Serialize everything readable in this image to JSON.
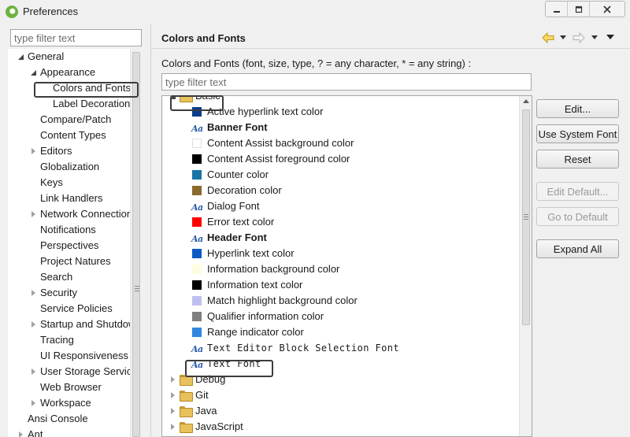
{
  "window": {
    "title": "Preferences",
    "controls": [
      "minimize-icon",
      "restore-icon",
      "close-icon"
    ]
  },
  "left": {
    "filter_placeholder": "type filter text",
    "tree": [
      {
        "label": "General",
        "level": 0,
        "expander": "open"
      },
      {
        "label": "Appearance",
        "level": 1,
        "expander": "open"
      },
      {
        "label": "Colors and Fonts",
        "level": 2,
        "expander": "none",
        "selected": true
      },
      {
        "label": "Label Decorations",
        "level": 2,
        "expander": "none"
      },
      {
        "label": "Compare/Patch",
        "level": 1,
        "expander": "none"
      },
      {
        "label": "Content Types",
        "level": 1,
        "expander": "none"
      },
      {
        "label": "Editors",
        "level": 1,
        "expander": "closed"
      },
      {
        "label": "Globalization",
        "level": 1,
        "expander": "none"
      },
      {
        "label": "Keys",
        "level": 1,
        "expander": "none"
      },
      {
        "label": "Link Handlers",
        "level": 1,
        "expander": "none"
      },
      {
        "label": "Network Connections",
        "level": 1,
        "expander": "closed"
      },
      {
        "label": "Notifications",
        "level": 1,
        "expander": "none"
      },
      {
        "label": "Perspectives",
        "level": 1,
        "expander": "none"
      },
      {
        "label": "Project Natures",
        "level": 1,
        "expander": "none"
      },
      {
        "label": "Search",
        "level": 1,
        "expander": "none"
      },
      {
        "label": "Security",
        "level": 1,
        "expander": "closed"
      },
      {
        "label": "Service Policies",
        "level": 1,
        "expander": "none"
      },
      {
        "label": "Startup and Shutdown",
        "level": 1,
        "expander": "closed"
      },
      {
        "label": "Tracing",
        "level": 1,
        "expander": "none"
      },
      {
        "label": "UI Responsiveness",
        "level": 1,
        "expander": "none"
      },
      {
        "label": "User Storage Service",
        "level": 1,
        "expander": "closed"
      },
      {
        "label": "Web Browser",
        "level": 1,
        "expander": "none"
      },
      {
        "label": "Workspace",
        "level": 1,
        "expander": "closed"
      },
      {
        "label": "Ansi Console",
        "level": 0,
        "expander": "none"
      },
      {
        "label": "Ant",
        "level": 0,
        "expander": "closed"
      }
    ]
  },
  "right": {
    "title": "Colors and Fonts",
    "nav_icons": [
      "back-arrow-icon",
      "back-menu-icon",
      "forward-arrow-icon",
      "forward-menu-icon",
      "view-menu-icon"
    ],
    "description": "Colors and Fonts (font, size, type, ? = any character, * = any string) :",
    "filter_placeholder": "type filter text",
    "items": [
      {
        "label": "Basic",
        "kind": "category",
        "expander": "open"
      },
      {
        "label": "Active hyperlink text color",
        "kind": "color",
        "color": "#0a3c8c"
      },
      {
        "label": "Banner Font",
        "kind": "font",
        "style": "bold"
      },
      {
        "label": "Content Assist background color",
        "kind": "color",
        "color": "#ffffff"
      },
      {
        "label": "Content Assist foreground color",
        "kind": "color",
        "color": "#000000"
      },
      {
        "label": "Counter color",
        "kind": "color",
        "color": "#1a73a6"
      },
      {
        "label": "Decoration color",
        "kind": "color",
        "color": "#8b6a2e"
      },
      {
        "label": "Dialog Font",
        "kind": "font",
        "style": "normal"
      },
      {
        "label": "Error text color",
        "kind": "color",
        "color": "#ff0000"
      },
      {
        "label": "Header Font",
        "kind": "font",
        "style": "bold"
      },
      {
        "label": "Hyperlink text color",
        "kind": "color",
        "color": "#0a5cc4"
      },
      {
        "label": "Information background color",
        "kind": "color",
        "color": "#fdfde1"
      },
      {
        "label": "Information text color",
        "kind": "color",
        "color": "#000000"
      },
      {
        "label": "Match highlight background color",
        "kind": "color",
        "color": "#c0c0f0"
      },
      {
        "label": "Qualifier information color",
        "kind": "color",
        "color": "#808080"
      },
      {
        "label": "Range indicator color",
        "kind": "color",
        "color": "#3088e0"
      },
      {
        "label": "Text Editor Block Selection Font",
        "kind": "font",
        "style": "mono"
      },
      {
        "label": "Text Font",
        "kind": "font",
        "style": "mono"
      },
      {
        "label": "Debug",
        "kind": "category",
        "expander": "closed"
      },
      {
        "label": "Git",
        "kind": "category",
        "expander": "closed"
      },
      {
        "label": "Java",
        "kind": "category",
        "expander": "closed"
      },
      {
        "label": "JavaScript",
        "kind": "category",
        "expander": "closed"
      }
    ],
    "buttons": [
      {
        "label": "Edit...",
        "enabled": true
      },
      {
        "label": "Use System Font",
        "enabled": true
      },
      {
        "label": "Reset",
        "enabled": true
      },
      {
        "label": "Edit Default...",
        "enabled": false
      },
      {
        "label": "Go to Default",
        "enabled": false
      },
      {
        "label": "Expand All",
        "enabled": true
      }
    ]
  }
}
